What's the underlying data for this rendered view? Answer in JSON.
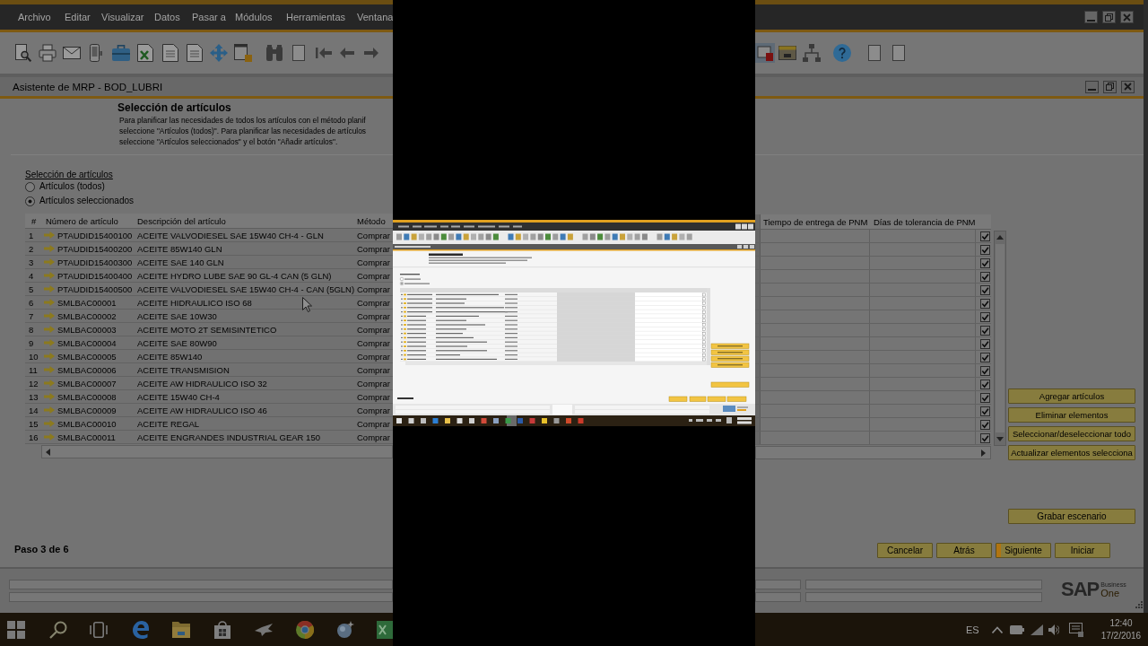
{
  "menu_bar": {
    "items": [
      "Archivo",
      "Editar",
      "Visualizar",
      "Datos",
      "Pasar a",
      "Módulos",
      "Herramientas",
      "Ventana"
    ]
  },
  "window": {
    "title": "Asistente de MRP - BOD_LUBRI"
  },
  "header": {
    "title": "Selección de artículos",
    "description": [
      "Para planificar las necesidades de todos los artículos con el método planif",
      "seleccione \"Artículos (todos)\". Para planificar las necesidades de artículos",
      "seleccione \"Artículos seleccionados\" y el botón \"Añadir artículos\"."
    ]
  },
  "item_selection": {
    "label": "Selección de artículos",
    "options": [
      {
        "label": "Artículos (todos)",
        "selected": false
      },
      {
        "label": "Artículos seleccionados",
        "selected": true
      }
    ]
  },
  "table": {
    "columns": [
      "#",
      "Número de artículo",
      "Descripción del artículo",
      "Método",
      "Tiempo de entrega de PNM",
      "Días de tolerancia de PNM"
    ],
    "rows": [
      {
        "number": "1",
        "item_number": "PTAUDID15400100",
        "description": "ACEITE VALVODIESEL SAE 15W40 CH-4 - GLN",
        "method": "Comprar",
        "checked": true
      },
      {
        "number": "2",
        "item_number": "PTAUDID15400200",
        "description": "ACEITE 85W140 GLN",
        "method": "Comprar",
        "checked": true
      },
      {
        "number": "3",
        "item_number": "PTAUDID15400300",
        "description": "ACEITE SAE 140 GLN",
        "method": "Comprar",
        "checked": true
      },
      {
        "number": "4",
        "item_number": "PTAUDID15400400",
        "description": "ACEITE HYDRO LUBE SAE 90 GL-4 CAN (5 GLN)",
        "method": "Comprar",
        "checked": true
      },
      {
        "number": "5",
        "item_number": "PTAUDID15400500",
        "description": "ACEITE VALVODIESEL SAE 15W40 CH-4 - CAN (5GLN)",
        "method": "Comprar",
        "checked": true
      },
      {
        "number": "6",
        "item_number": "SMLBAC00001",
        "description": "ACEITE HIDRAULICO ISO 68",
        "method": "Comprar",
        "checked": true
      },
      {
        "number": "7",
        "item_number": "SMLBAC00002",
        "description": "ACEITE SAE 10W30",
        "method": "Comprar",
        "checked": true
      },
      {
        "number": "8",
        "item_number": "SMLBAC00003",
        "description": "ACEITE MOTO 2T SEMISINTETICO",
        "method": "Comprar",
        "checked": true
      },
      {
        "number": "9",
        "item_number": "SMLBAC00004",
        "description": "ACEITE SAE 80W90",
        "method": "Comprar",
        "checked": true
      },
      {
        "number": "10",
        "item_number": "SMLBAC00005",
        "description": "ACEITE 85W140",
        "method": "Comprar",
        "checked": true
      },
      {
        "number": "11",
        "item_number": "SMLBAC00006",
        "description": "ACEITE TRANSMISION",
        "method": "Comprar",
        "checked": true
      },
      {
        "number": "12",
        "item_number": "SMLBAC00007",
        "description": "ACEITE AW HIDRAULICO ISO 32",
        "method": "Comprar",
        "checked": true
      },
      {
        "number": "13",
        "item_number": "SMLBAC00008",
        "description": "ACEITE 15W40 CH-4",
        "method": "Comprar",
        "checked": true
      },
      {
        "number": "14",
        "item_number": "SMLBAC00009",
        "description": "ACEITE AW HIDRAULICO ISO 46",
        "method": "Comprar",
        "checked": true
      },
      {
        "number": "15",
        "item_number": "SMLBAC00010",
        "description": "ACEITE REGAL",
        "method": "Comprar",
        "checked": true
      },
      {
        "number": "16",
        "item_number": "SMLBAC00011",
        "description": "ACEITE ENGRANDES INDUSTRIAL GEAR 150",
        "method": "Comprar",
        "checked": true
      }
    ]
  },
  "side_buttons": [
    "Agregar artículos",
    "Eliminar elementos",
    "Seleccionar/deseleccionar todo",
    "Actualizar elementos selecciona"
  ],
  "scenario_button": "Grabar escenario",
  "step": "Paso 3 de 6",
  "nav_buttons": [
    {
      "label": "Cancelar",
      "focused": false
    },
    {
      "label": "Atrás",
      "focused": false
    },
    {
      "label": "Siguiente",
      "focused": true
    },
    {
      "label": "Iniciar",
      "focused": false
    }
  ],
  "status_bar": {
    "logo": {
      "brand": "SAP",
      "line_1": "Business",
      "line_2": "One"
    }
  },
  "taskbar": {
    "language": "ES",
    "time": "12:40",
    "date": "17/2/2016"
  }
}
